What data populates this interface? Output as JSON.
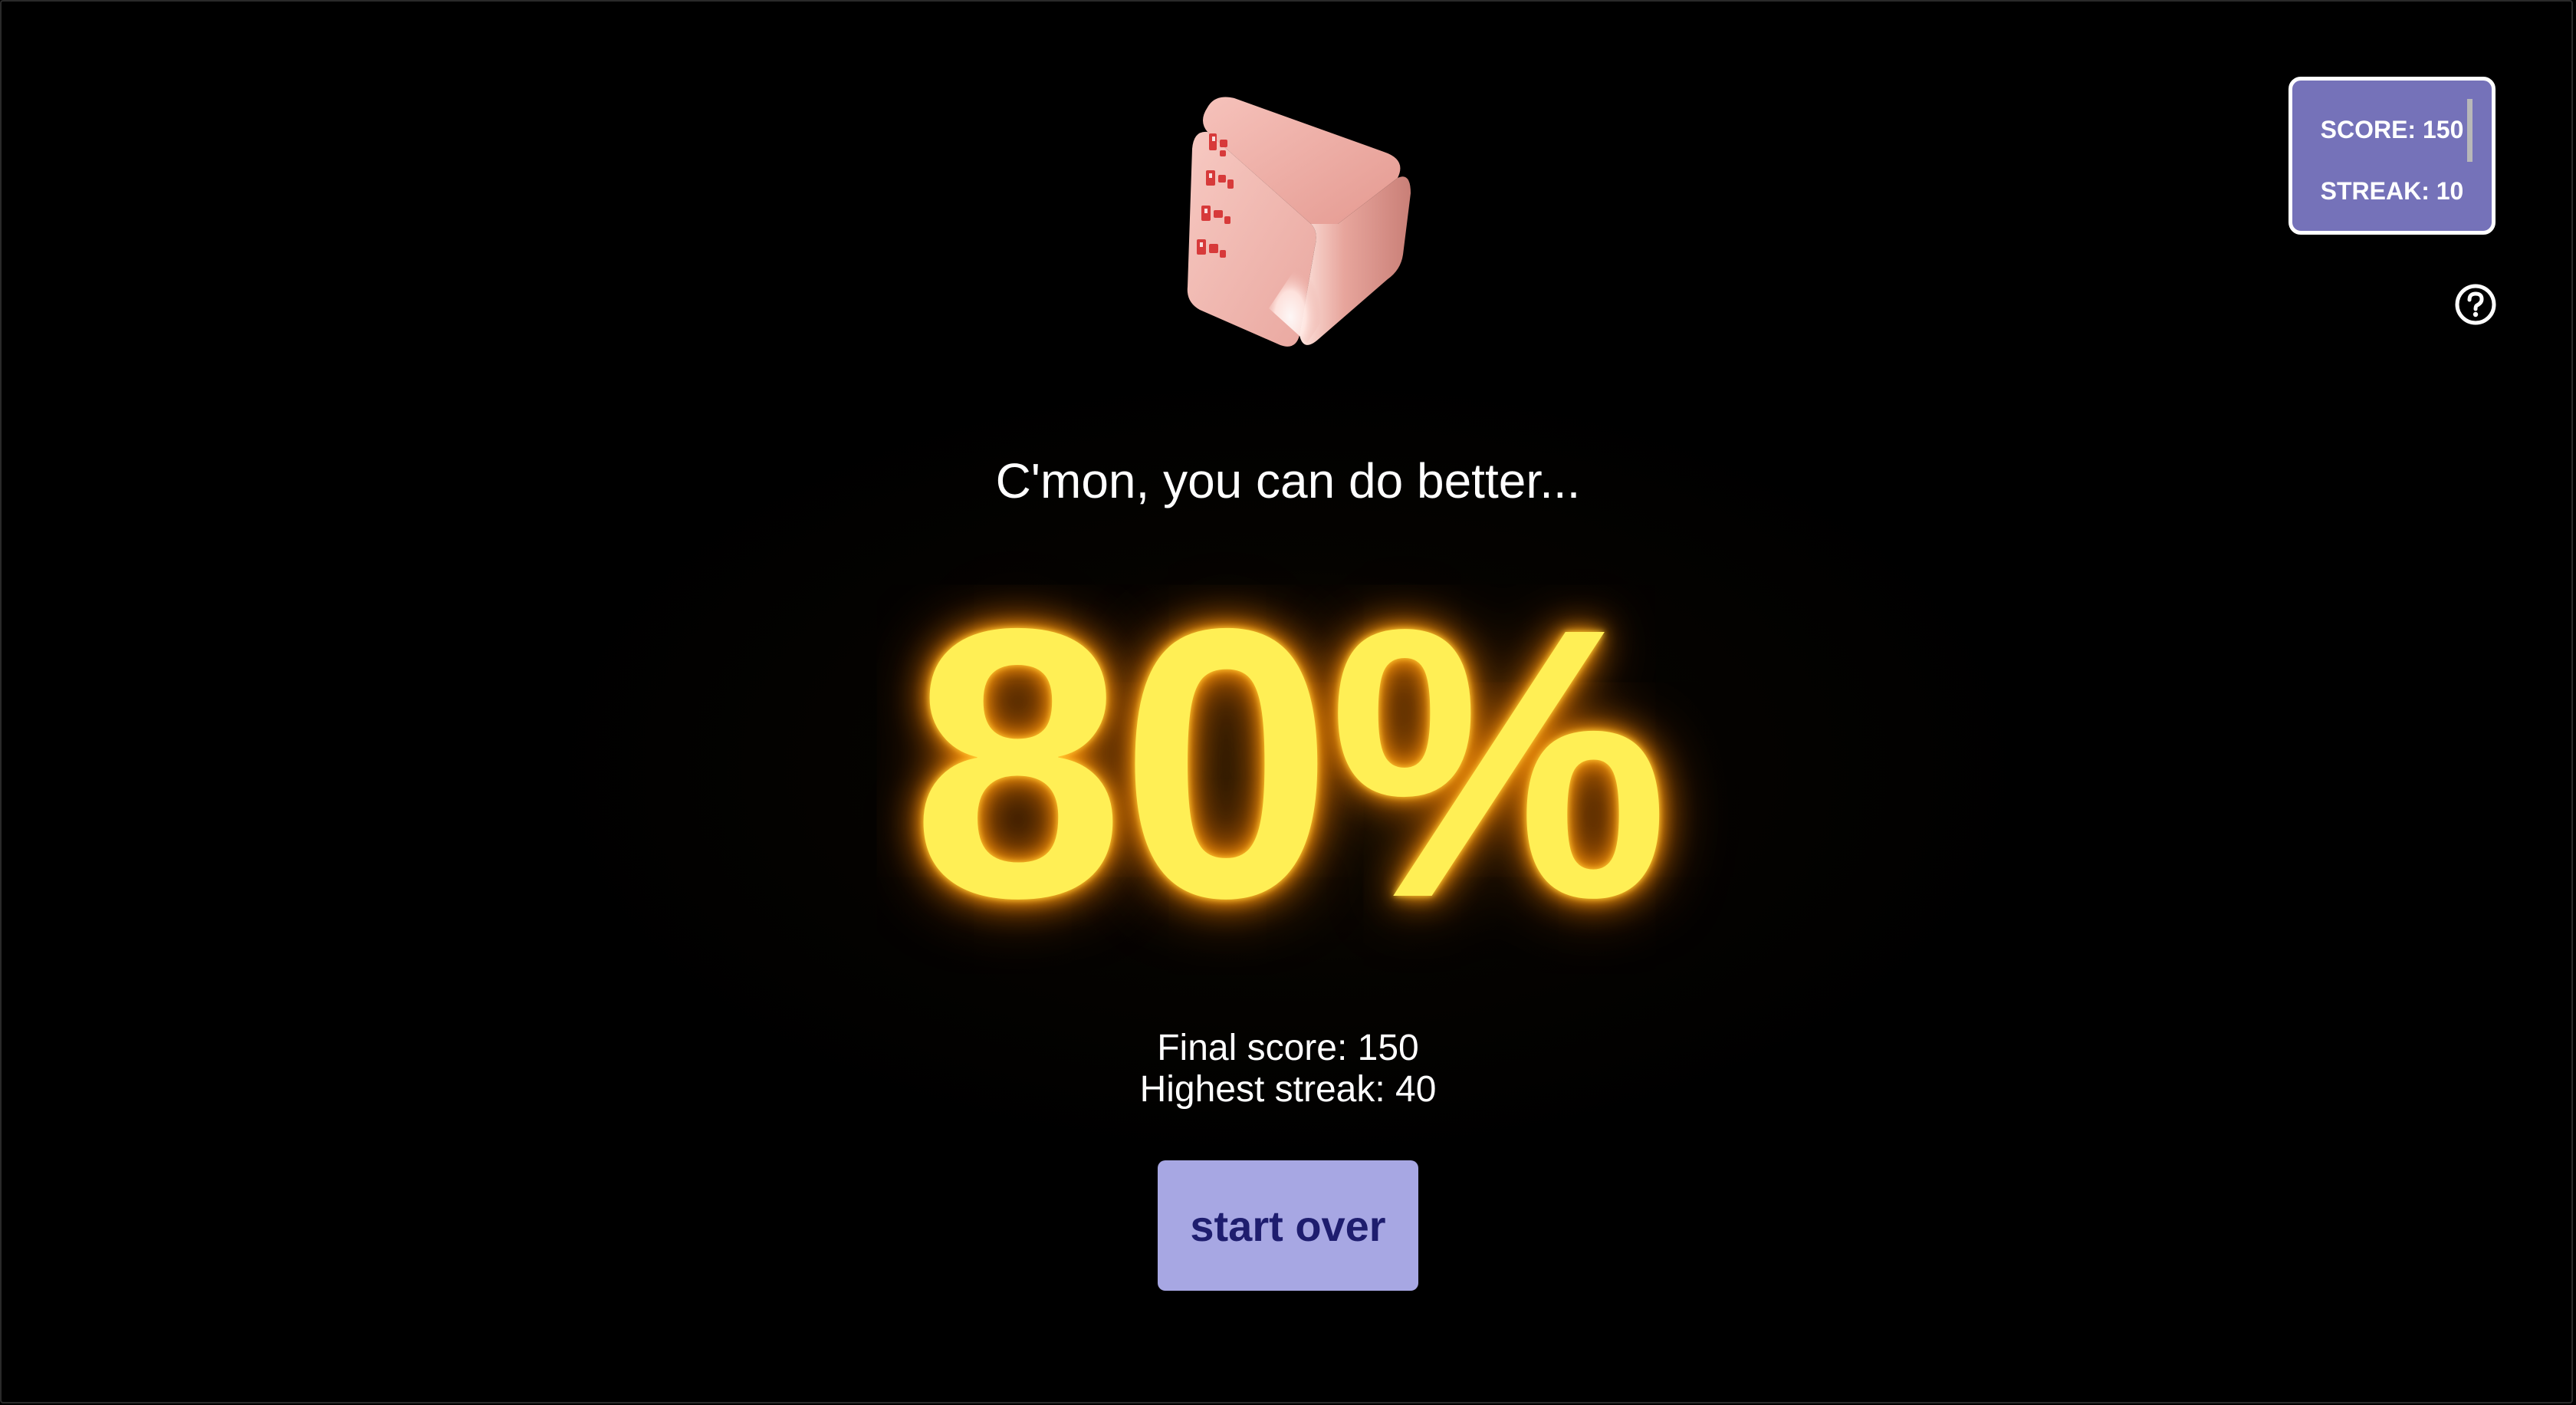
{
  "hud": {
    "score_text": "SCORE: 150",
    "streak_text": "STREAK: 10"
  },
  "help": {
    "icon": "question-circle-icon"
  },
  "die": {
    "icon": "die-icon",
    "color": "#f0a8a0"
  },
  "result": {
    "message": "C'mon, you can do better...",
    "percent": "80%",
    "final_score": "Final score: 150",
    "highest_streak": "Highest streak: 40"
  },
  "actions": {
    "start_over_label": "start over"
  },
  "colors": {
    "background": "#000000",
    "panel": "#7572b9",
    "button": "#a7a7e3",
    "button_text": "#1e1d6e",
    "percent": "#ffef55",
    "glow": "#ff8a00"
  }
}
